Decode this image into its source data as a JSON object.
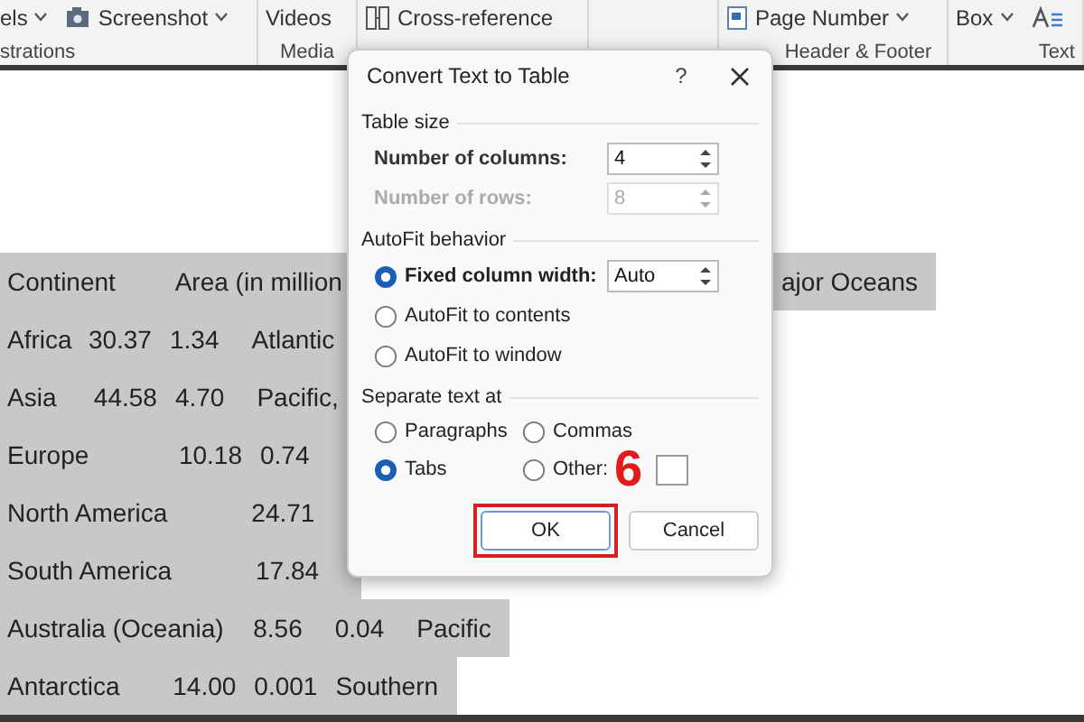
{
  "ribbon": {
    "groups": [
      {
        "items": [
          {
            "label": "els",
            "caret": true
          },
          {
            "label": "Screenshot",
            "caret": true
          }
        ],
        "label": "strations"
      },
      {
        "items": [
          {
            "label": "Videos",
            "caret": false
          }
        ],
        "label": "Media"
      },
      {
        "items": [
          {
            "label": "Cross-reference",
            "caret": false
          }
        ]
      },
      {
        "items": [
          {
            "label": "Page Number",
            "caret": true
          }
        ],
        "label": "Header & Footer"
      },
      {
        "items": [
          {
            "label": "Box",
            "caret": true
          }
        ],
        "label": "Text"
      }
    ]
  },
  "document": {
    "lines": [
      {
        "segments": [
          "Continent",
          "Area (in million"
        ],
        "tail": "ajor Oceans"
      },
      {
        "segments": [
          "Africa",
          "30.37",
          "1.34",
          "Atlantic"
        ]
      },
      {
        "segments": [
          "Asia",
          "44.58",
          "4.70",
          "Pacific,"
        ]
      },
      {
        "segments": [
          "Europe",
          "10.18",
          "0.74"
        ]
      },
      {
        "segments": [
          "North America",
          "24.71"
        ]
      },
      {
        "segments": [
          "South America",
          "17.84"
        ]
      },
      {
        "segments": [
          "Australia (Oceania)",
          "8.56",
          "0.04",
          "Pacific"
        ]
      },
      {
        "segments": [
          "Antarctica",
          "14.00",
          "0.001",
          "Southern"
        ]
      }
    ]
  },
  "dialog": {
    "title": "Convert Text to Table",
    "help": "?",
    "table_size": {
      "heading": "Table size",
      "fields": [
        {
          "label": "Number of columns:",
          "value": "4",
          "disabled": false
        },
        {
          "label": "Number of rows:",
          "value": "8",
          "disabled": true
        }
      ]
    },
    "autofit": {
      "heading": "AutoFit behavior",
      "options": [
        {
          "label": "Fixed column width:",
          "selected": true,
          "value": "Auto"
        },
        {
          "label": "AutoFit to contents",
          "selected": false
        },
        {
          "label": "AutoFit to window",
          "selected": false
        }
      ]
    },
    "separate": {
      "heading": "Separate text at",
      "options": [
        {
          "label": "Paragraphs",
          "selected": false
        },
        {
          "label": "Commas",
          "selected": false
        },
        {
          "label": "Tabs",
          "selected": true
        },
        {
          "label": "Other:",
          "selected": false
        }
      ]
    },
    "buttons": [
      {
        "label": "OK",
        "annotated": true
      },
      {
        "label": "Cancel",
        "annotated": false
      }
    ],
    "annotation": "6"
  }
}
